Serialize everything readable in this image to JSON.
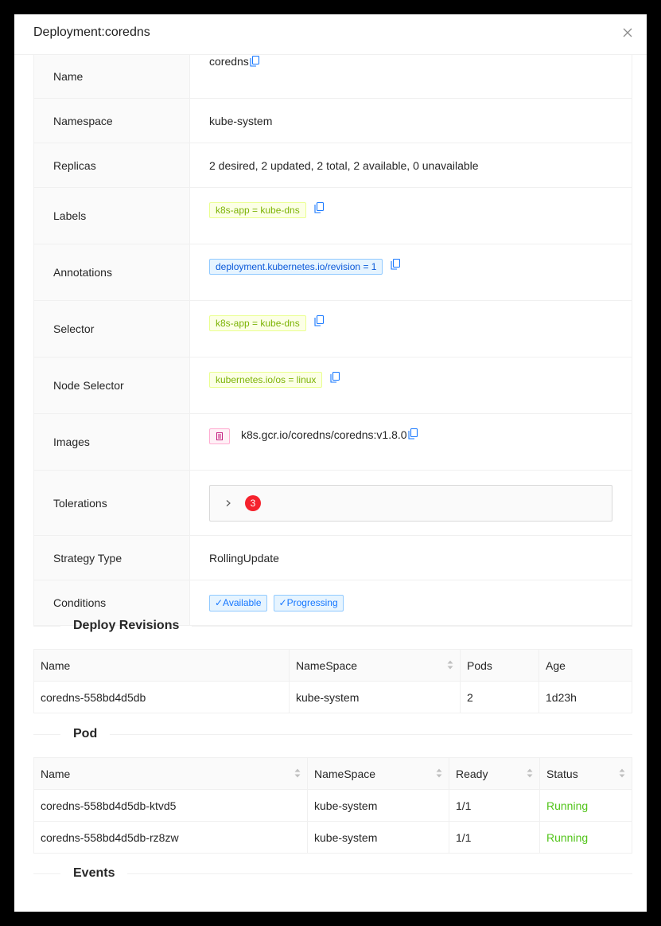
{
  "modal": {
    "title": "Deployment:coredns"
  },
  "details": {
    "name_label": "Name",
    "name_value": "coredns",
    "namespace_label": "Namespace",
    "namespace_value": "kube-system",
    "replicas_label": "Replicas",
    "replicas_value": "2 desired, 2 updated, 2 total, 2 available, 0 unavailable",
    "labels_label": "Labels",
    "labels_tag": "k8s-app = kube-dns",
    "annotations_label": "Annotations",
    "annotations_tag": "deployment.kubernetes.io/revision = 1",
    "selector_label": "Selector",
    "selector_tag": "k8s-app = kube-dns",
    "node_selector_label": "Node Selector",
    "node_selector_tag": "kubernetes.io/os = linux",
    "images_label": "Images",
    "images_value": "k8s.gcr.io/coredns/coredns:v1.8.0",
    "tolerations_label": "Tolerations",
    "tolerations_count": "3",
    "strategy_label": "Strategy Type",
    "strategy_value": "RollingUpdate",
    "conditions_label": "Conditions",
    "conditions": [
      "✓Available",
      "✓Progressing"
    ]
  },
  "revisions": {
    "title": "Deploy Revisions",
    "columns": [
      "Name",
      "NameSpace",
      "Pods",
      "Age"
    ],
    "rows": [
      [
        "coredns-558bd4d5db",
        "kube-system",
        "2",
        "1d23h"
      ]
    ]
  },
  "pods": {
    "title": "Pod",
    "columns": [
      "Name",
      "NameSpace",
      "Ready",
      "Status"
    ],
    "rows": [
      [
        "coredns-558bd4d5db-ktvd5",
        "kube-system",
        "1/1",
        "Running"
      ],
      [
        "coredns-558bd4d5db-rz8zw",
        "kube-system",
        "1/1",
        "Running"
      ]
    ]
  },
  "events": {
    "title": "Events"
  },
  "colors": {
    "running": "#52c41a",
    "badge": "#f5222d",
    "copy_icon": "#1677ff"
  },
  "icons": [
    "close-icon",
    "copy-icon",
    "file-icon",
    "chevron-right-icon",
    "sort-icon"
  ]
}
